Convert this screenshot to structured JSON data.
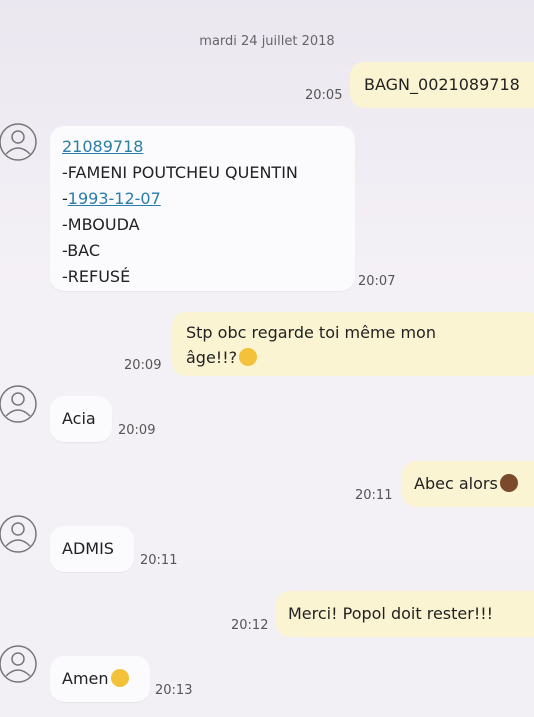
{
  "date_separator": "mardi 24 juillet 2018",
  "messages": [
    {
      "text": "BAGN_0021089718",
      "time": "20:05"
    },
    {
      "link_line": "21089718",
      "lines": [
        "-FAMENI POUTCHEU QUENTIN",
        "-",
        "-MBOUDA",
        "-BAC",
        "-REFUSÉ"
      ],
      "date_link": "1993-12-07",
      "time": "20:07"
    },
    {
      "line1": "Stp obc regarde toi même mon",
      "line2": "âge!!?",
      "emoji": "grimace-emoji",
      "time": "20:09"
    },
    {
      "text": "Acia",
      "time": "20:09"
    },
    {
      "text": "Abec alors",
      "emoji": "facepalm-emoji",
      "time": "20:11"
    },
    {
      "text": "ADMIS",
      "time": "20:11"
    },
    {
      "text": "Merci! Popol doit rester!!!",
      "time": "20:12"
    },
    {
      "text": "Amen",
      "emoji": "kiss-emoji",
      "time": "20:13"
    }
  ]
}
